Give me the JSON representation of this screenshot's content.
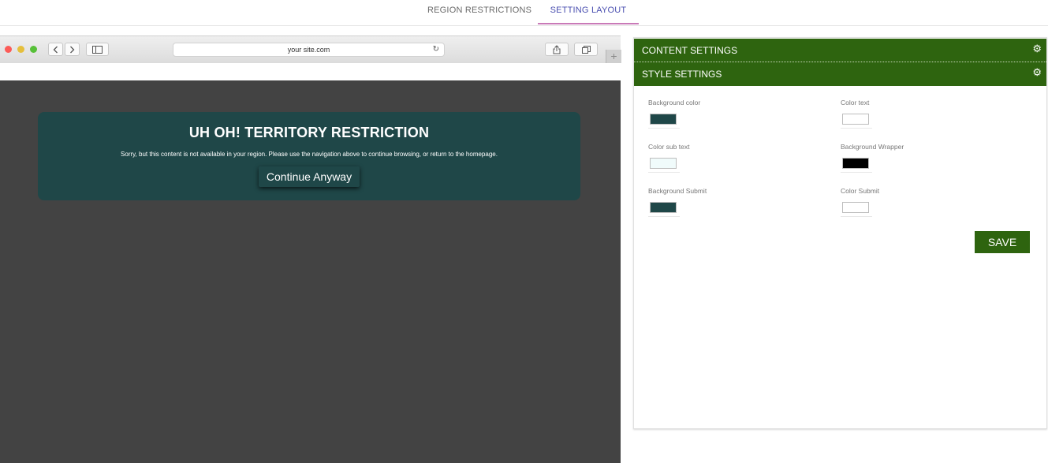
{
  "tabs": {
    "region_restrictions": "REGION RESTRICTIONS",
    "setting_layout": "SETTING LAYOUT"
  },
  "browser": {
    "address": "your site.com",
    "icons": {
      "back": "chevron-left-icon",
      "forward": "chevron-right-icon",
      "sidebar": "sidebar-icon",
      "reload": "reload-icon",
      "share": "share-icon",
      "tabs": "tabs-icon",
      "new_tab": "plus-icon"
    }
  },
  "preview": {
    "title": "UH OH! TERRITORY RESTRICTION",
    "message": "Sorry, but this content is not available in your region. Please use the navigation above to continue browsing, or return to the homepage.",
    "button": "Continue Anyway",
    "page_background": "#434343",
    "box_background": "#1f4748"
  },
  "panel": {
    "content_settings": "CONTENT SETTINGS",
    "style_settings": "STYLE SETTINGS",
    "accent": "#2e640f",
    "fields": [
      {
        "label": "Background color",
        "color": "#1f4748"
      },
      {
        "label": "Color text",
        "color": "#ffffff"
      },
      {
        "label": "Color sub text",
        "color": "#f0fbfb"
      },
      {
        "label": "Background Wrapper",
        "color": "#000000"
      },
      {
        "label": "Background Submit",
        "color": "#1f4748"
      },
      {
        "label": "Color Submit",
        "color": "#ffffff"
      }
    ],
    "save": "SAVE"
  }
}
